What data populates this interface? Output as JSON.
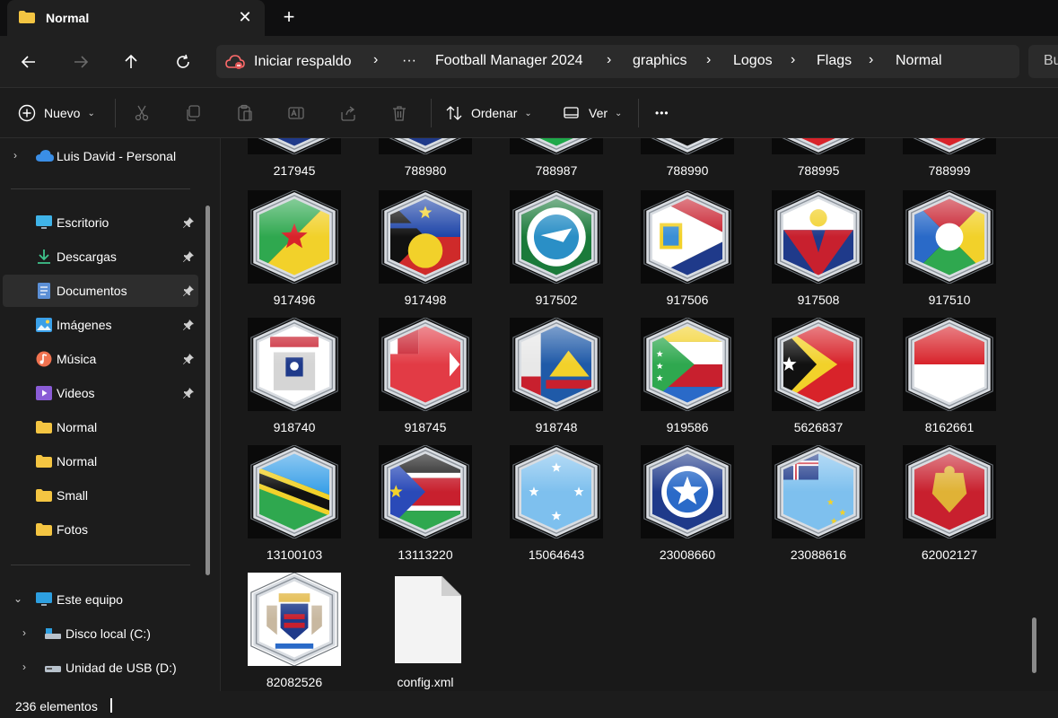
{
  "tab": {
    "title": "Normal",
    "close_glyph": "✕",
    "new_tab_glyph": "+"
  },
  "nav": {
    "backup_label": "Iniciar respaldo",
    "ellipsis": "···",
    "breadcrumbs": [
      "Football Manager 2024",
      "graphics",
      "Logos",
      "Flags",
      "Normal"
    ],
    "separator": "›",
    "search_partial": "Bu"
  },
  "commands": {
    "new_label": "Nuevo",
    "sort_label": "Ordenar",
    "view_label": "Ver",
    "more_glyph": "•••"
  },
  "sidebar": {
    "onedrive_label": "Luis David - Personal",
    "quick_access": [
      {
        "label": "Escritorio",
        "icon": "desktop-icon",
        "pinned": true
      },
      {
        "label": "Descargas",
        "icon": "download-icon",
        "pinned": true
      },
      {
        "label": "Documentos",
        "icon": "documents-icon",
        "pinned": true,
        "selected": true
      },
      {
        "label": "Imágenes",
        "icon": "pictures-icon",
        "pinned": true
      },
      {
        "label": "Música",
        "icon": "music-icon",
        "pinned": true
      },
      {
        "label": "Videos",
        "icon": "videos-icon",
        "pinned": true
      },
      {
        "label": "Normal",
        "icon": "folder-icon",
        "pinned": false
      },
      {
        "label": "Normal",
        "icon": "folder-icon",
        "pinned": false
      },
      {
        "label": "Small",
        "icon": "folder-icon",
        "pinned": false
      },
      {
        "label": "Fotos",
        "icon": "folder-icon",
        "pinned": false
      }
    ],
    "this_pc_label": "Este equipo",
    "drives": [
      {
        "label": "Disco local (C:)",
        "icon": "local-disk-icon"
      },
      {
        "label": "Unidad de USB (D:)",
        "icon": "usb-drive-icon"
      }
    ]
  },
  "files": {
    "top_row": [
      "217945",
      "788980",
      "788987",
      "788990",
      "788995",
      "788999"
    ],
    "rows": [
      [
        "917496",
        "917498",
        "917502",
        "917506",
        "917508",
        "917510"
      ],
      [
        "918740",
        "918745",
        "918748",
        "919586",
        "5626837",
        "8162661"
      ],
      [
        "13100103",
        "13113220",
        "15064643",
        "23008660",
        "23088616",
        "62002127"
      ],
      [
        "82082526",
        "config.xml"
      ]
    ]
  },
  "status": {
    "item_count": "236 elementos"
  },
  "colors": {
    "accent": "#4cc2ff",
    "folder": "#f4c542",
    "background": "#191919"
  }
}
